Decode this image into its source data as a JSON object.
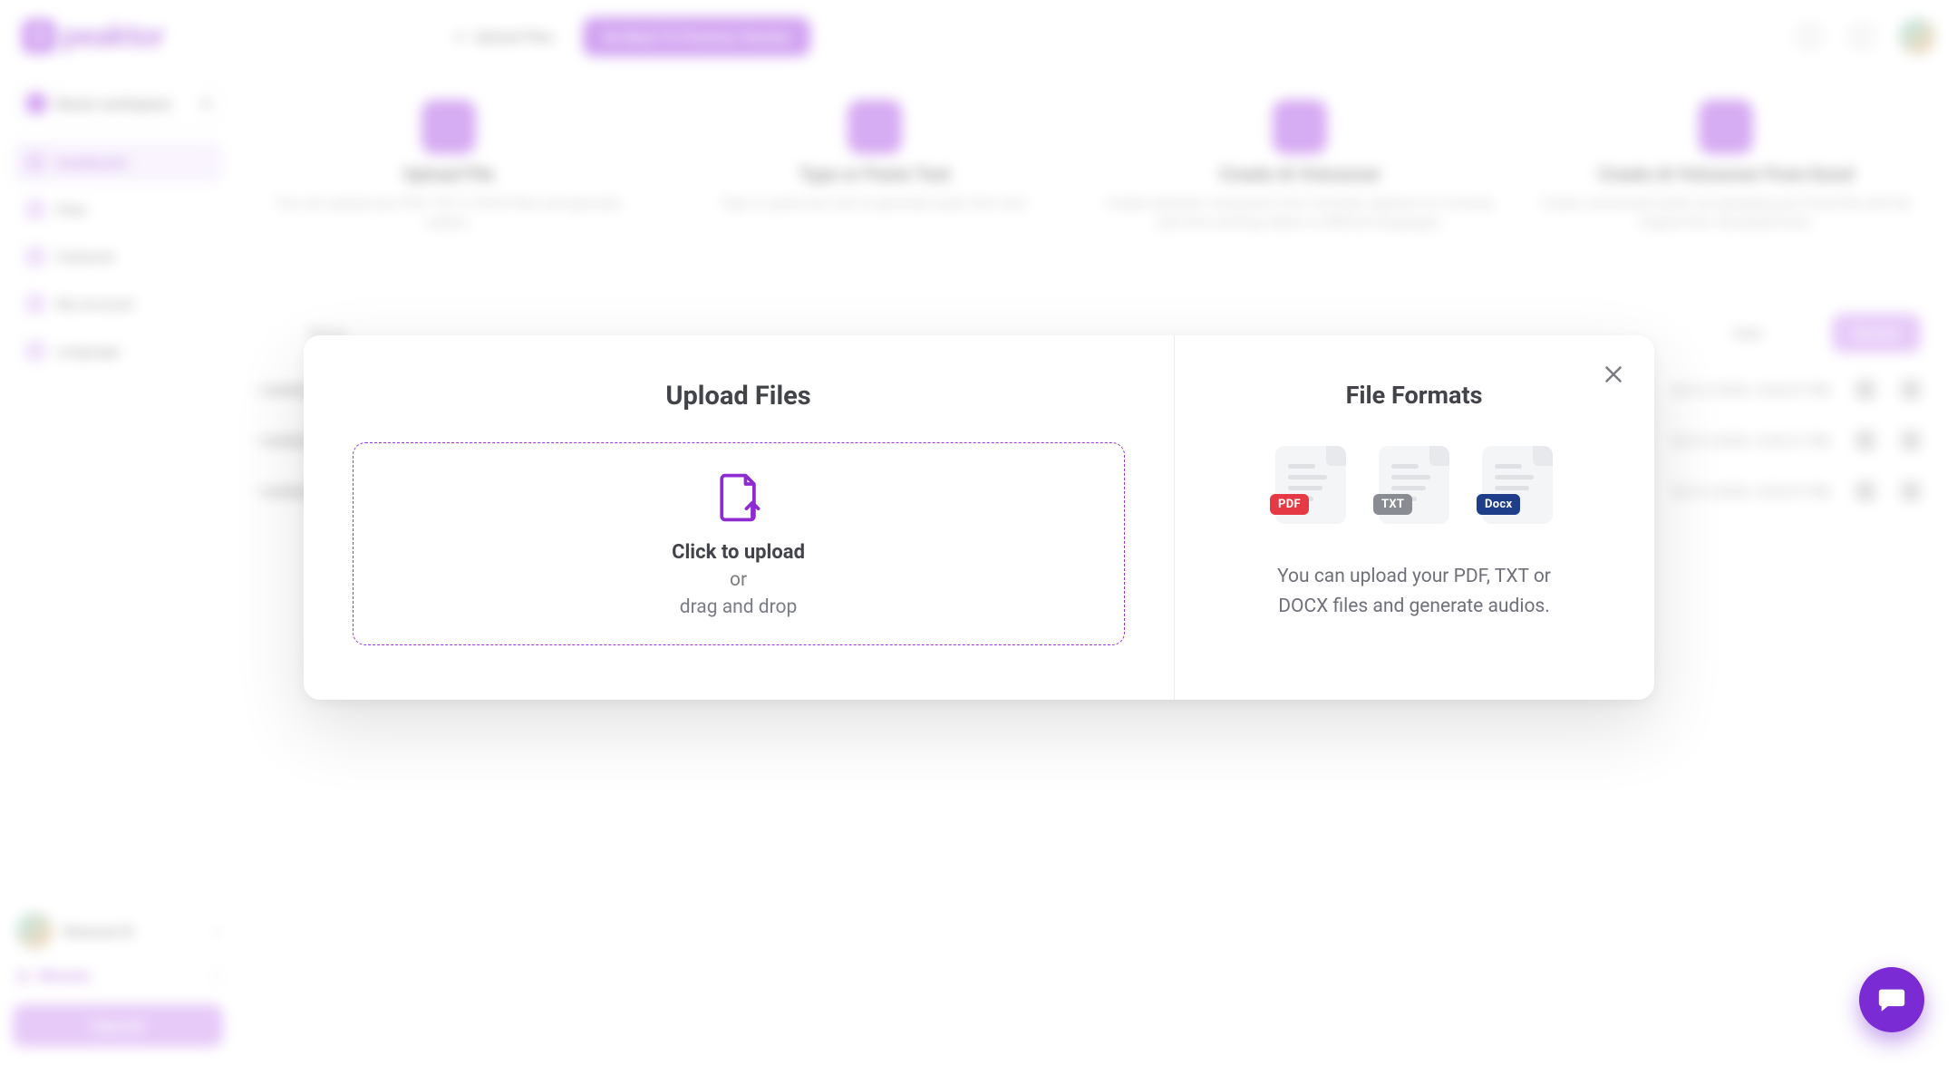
{
  "brand": {
    "name": "peaktor",
    "square_letter": "S"
  },
  "topbar": {
    "upload_btn": "Upload Files",
    "go_back_btn": "Go Back To Previous Version"
  },
  "sidebar": {
    "workspace_label": "Rana's workspace",
    "items": [
      {
        "label": "Dashboard"
      },
      {
        "label": "Files"
      },
      {
        "label": "Featured"
      },
      {
        "label": "My Account"
      },
      {
        "label": "Language"
      }
    ],
    "user_name": "Ranacan B.",
    "minutes_label": "Minutes",
    "upgrade_label": "Upgrade"
  },
  "cards": [
    {
      "title": "Upload File",
      "desc": "You can upload your PDF, TXT or DOCX files and generate audios."
    },
    {
      "title": "Type or Paste Text",
      "desc": "Type or paste your text to generate audio from text."
    },
    {
      "title": "Create AI Voiceover",
      "desc": "Create authentic voiceovers from YouTube captions for in-house ads from existing videos in different languages."
    },
    {
      "title": "Create AI Voiceover From Excel",
      "desc": "Create customized audio, by uploading your Excel file with the original text, translated texts."
    }
  ],
  "filter": {
    "pill_label": "Recent"
  },
  "rows": [
    {
      "name": "• Untitled File (3)",
      "date": "02/21/2025, 3:06:07 PM"
    },
    {
      "name": "• Untitled File (2)",
      "date": "02/21/2025, 3:05:21 PM"
    },
    {
      "name": "• Untitled File (1)",
      "date": "02/21/2025, 3:04:57 PM"
    }
  ],
  "table_header": {
    "name": "Name",
    "date": "Date"
  },
  "modal": {
    "title_left": "Upload Files",
    "drop_line1": "Click to upload",
    "drop_line2": "or",
    "drop_line3": "drag and drop",
    "title_right": "File Formats",
    "badges": {
      "pdf": "PDF",
      "txt": "TXT",
      "docx": "Docx"
    },
    "desc": "You can upload your PDF, TXT or DOCX files and generate audios."
  }
}
